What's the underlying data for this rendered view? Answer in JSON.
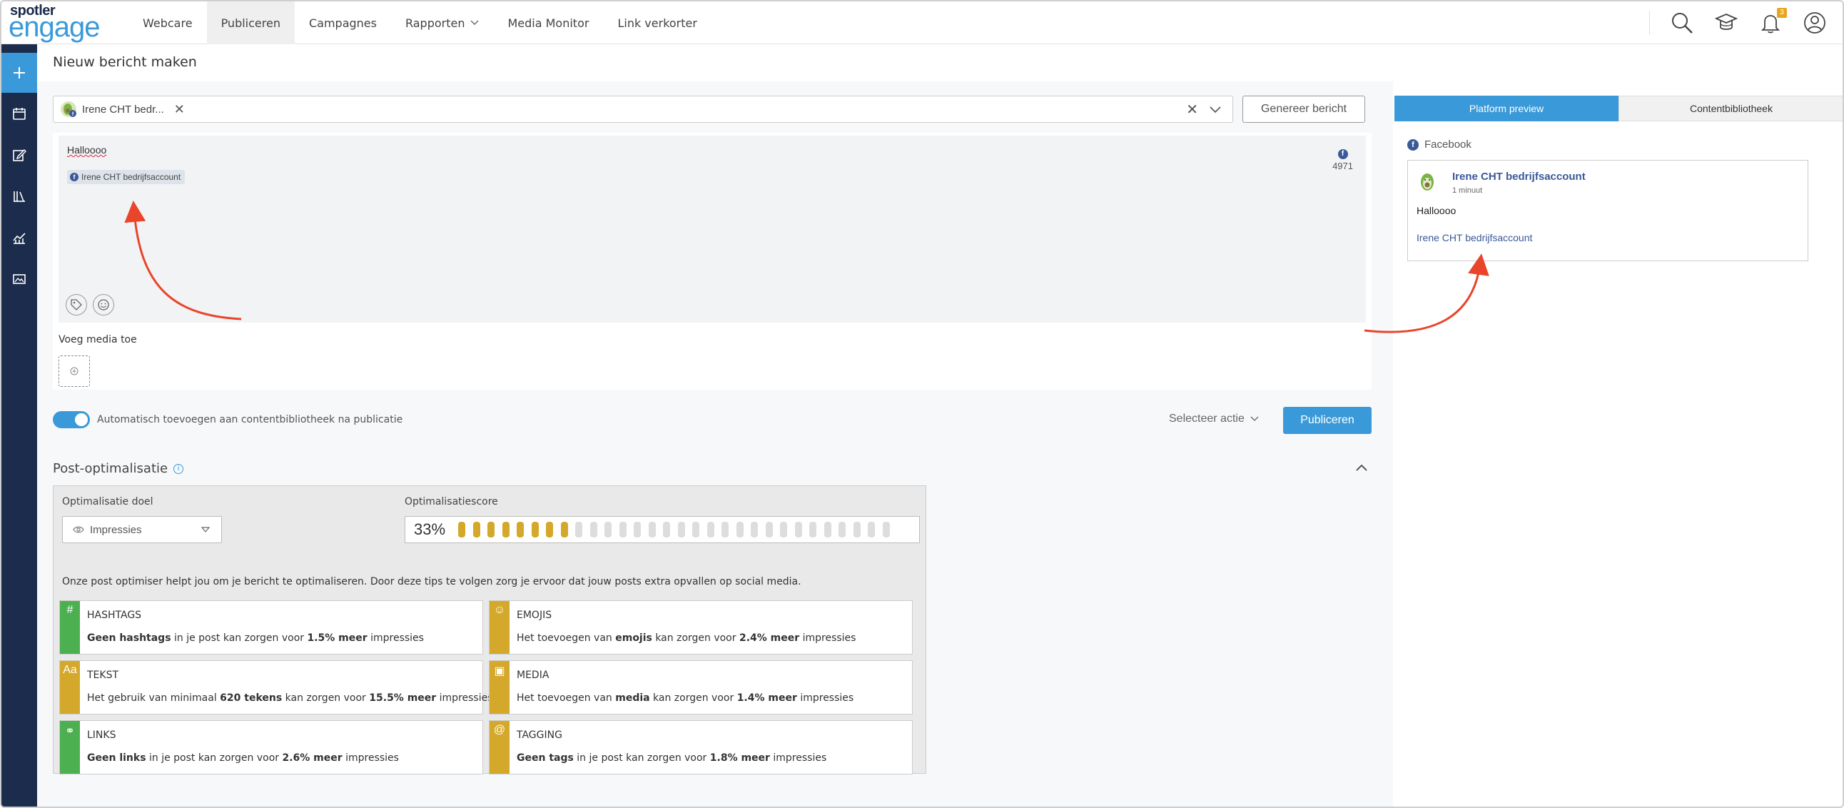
{
  "brand": {
    "line1": "spotler",
    "line2": "engage",
    "accent": "#3a9ad9",
    "dark": "#1c2c4d"
  },
  "nav": [
    {
      "label": "Webcare"
    },
    {
      "label": "Publiceren",
      "active": true
    },
    {
      "label": "Campagnes"
    },
    {
      "label": "Rapporten",
      "dropdown": true
    },
    {
      "label": "Media Monitor"
    },
    {
      "label": "Link verkorter"
    }
  ],
  "top_icons": [
    "search-icon",
    "academy-icon",
    "bell-icon",
    "user-icon"
  ],
  "notifications": {
    "count": "3"
  },
  "sidebar": [
    "plus-icon",
    "calendar-icon",
    "edit-icon",
    "library-icon",
    "analytics-icon",
    "image-icon"
  ],
  "page": {
    "title": "Nieuw bericht maken"
  },
  "composer": {
    "account_chip": "Irene CHT bedr...",
    "generate_label": "Genereer bericht",
    "text": "Halloooo",
    "tag": "Irene CHT bedrijfsaccount",
    "char_count": "4971",
    "media_label": "Voeg media toe",
    "auto_add_label": "Automatisch toevoegen aan contentbibliotheek na publicatie",
    "auto_add_on": true,
    "select_action": "Selecteer actie",
    "publish_label": "Publiceren"
  },
  "optimisation": {
    "title": "Post-optimalisatie",
    "goal_label": "Optimalisatie doel",
    "goal_value": "Impressies",
    "score_label": "Optimalisatiescore",
    "score": "33%",
    "score_fraction": 0.33,
    "segments_total": 30,
    "segments_on": 8,
    "description": "Onze post optimiser helpt jou om je bericht te optimaliseren. Door deze tips te volgen zorg je ervoor dat jouw posts extra opvallen op social media.",
    "cards": [
      {
        "title": "HASHTAGS",
        "icon": "#",
        "color": "green",
        "parts": [
          [
            "Geen hashtags",
            true
          ],
          [
            " in je post kan zorgen voor ",
            false
          ],
          [
            "1.5% meer",
            true
          ],
          [
            " impressies",
            false
          ]
        ]
      },
      {
        "title": "EMOJIS",
        "icon": "☺",
        "color": "gold",
        "parts": [
          [
            "Het toevoegen van ",
            false
          ],
          [
            "emojis",
            true
          ],
          [
            " kan zorgen voor ",
            false
          ],
          [
            "2.4% meer",
            true
          ],
          [
            " impressies",
            false
          ]
        ]
      },
      {
        "title": "TEKST",
        "icon": "Aa",
        "color": "gold",
        "parts": [
          [
            "Het gebruik van minimaal ",
            false
          ],
          [
            "620 tekens",
            true
          ],
          [
            " kan zorgen voor ",
            false
          ],
          [
            "15.5% meer",
            true
          ],
          [
            " impressies",
            false
          ]
        ]
      },
      {
        "title": "MEDIA",
        "icon": "▣",
        "color": "gold",
        "parts": [
          [
            "Het toevoegen van ",
            false
          ],
          [
            "media",
            true
          ],
          [
            " kan zorgen voor ",
            false
          ],
          [
            "1.4% meer",
            true
          ],
          [
            " impressies",
            false
          ]
        ]
      },
      {
        "title": "LINKS",
        "icon": "⚭",
        "color": "green",
        "parts": [
          [
            "Geen links",
            true
          ],
          [
            " in je post kan zorgen voor ",
            false
          ],
          [
            "2.6% meer",
            true
          ],
          [
            " impressies",
            false
          ]
        ]
      },
      {
        "title": "TAGGING",
        "icon": "@",
        "color": "gold",
        "parts": [
          [
            "Geen tags",
            true
          ],
          [
            " in je post kan zorgen voor ",
            false
          ],
          [
            "1.8% meer",
            true
          ],
          [
            " impressies",
            false
          ]
        ]
      }
    ]
  },
  "preview": {
    "tab_active": "Platform preview",
    "tab_inactive": "Contentbibliotheek",
    "platform": "Facebook",
    "account": "Irene CHT bedrijfsaccount",
    "time": "1 minuut",
    "text": "Halloooo",
    "link": "Irene CHT bedrijfsaccount"
  }
}
